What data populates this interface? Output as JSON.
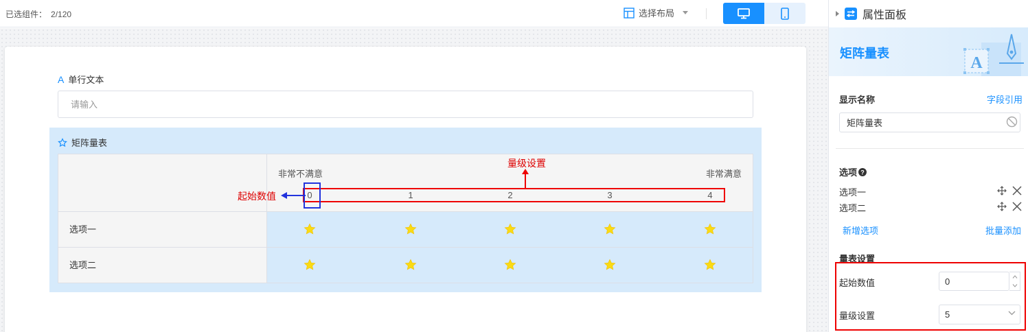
{
  "topbar": {
    "selected_label": "已选组件：",
    "selected_count": "2/120",
    "layout_label": "选择布局"
  },
  "form": {
    "single_text": {
      "label": "单行文本",
      "placeholder": "请输入"
    },
    "matrix": {
      "title": "矩阵量表",
      "left_label": "非常不满意",
      "right_label": "非常满意",
      "scale": [
        "0",
        "1",
        "2",
        "3",
        "4"
      ],
      "rows": [
        "选项一",
        "选项二"
      ],
      "star_color": "#fadb14"
    }
  },
  "annotations": {
    "level_setting": "量级设置",
    "start_value": "起始数值"
  },
  "panel": {
    "title": "属性面板",
    "banner_title": "矩阵量表",
    "display_name_label": "显示名称",
    "field_ref_link": "字段引用",
    "display_name_value": "矩阵量表",
    "options_label": "选项",
    "options": [
      "选项一",
      "选项二"
    ],
    "add_option": "新增选项",
    "batch_add": "批量添加",
    "scale_settings_label": "量表设置",
    "start_value_label": "起始数值",
    "start_value": "0",
    "level_label": "量级设置",
    "level_value": "5"
  },
  "colors": {
    "accent": "#1890ff",
    "matrix_bg": "#d6eafb",
    "annotation_red": "#e00000",
    "annotation_blue": "#2233dd"
  }
}
